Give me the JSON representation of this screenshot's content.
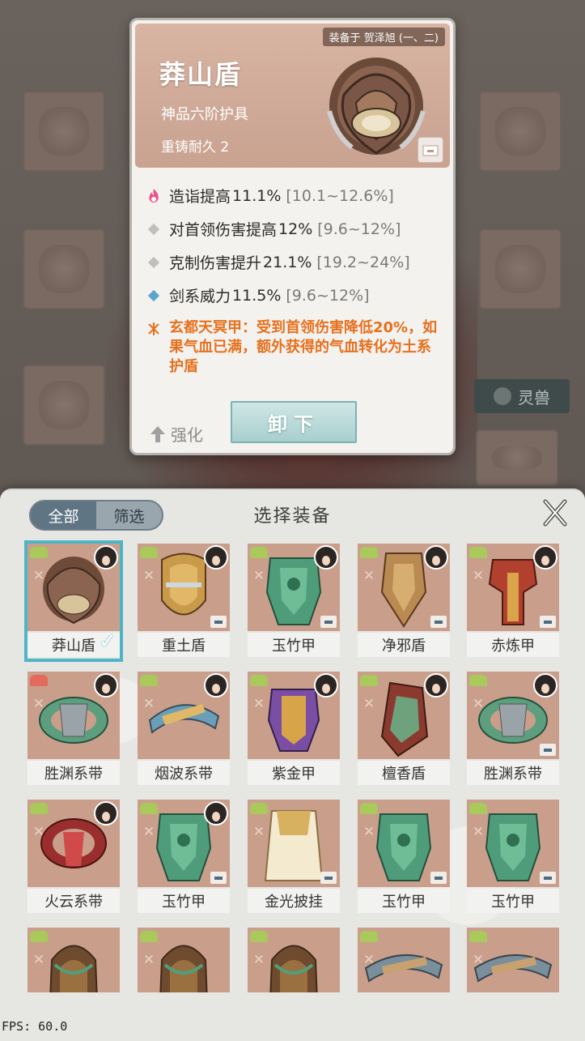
{
  "background": {
    "tab_lingshou": "灵兽"
  },
  "detail": {
    "equipped_on": "装备于 贺泽旭 (一、二)",
    "title": "莽山盾",
    "grade": "神品六阶护具",
    "recast": "重铸耐久 2",
    "stats": [
      {
        "label": "造诣提高",
        "value": "11.1%",
        "range": "[10.1~12.6%]",
        "icon": "flame-icon"
      },
      {
        "label": "对首领伤害提高",
        "value": "12%",
        "range": "[9.6~12%]",
        "icon": "diamond-icon"
      },
      {
        "label": "克制伤害提升",
        "value": "21.1%",
        "range": "[19.2~24%]",
        "icon": "diamond-icon"
      },
      {
        "label": "剑系威力",
        "value": "11.5%",
        "range": "[9.6~12%]",
        "icon": "diamond-blue-icon"
      }
    ],
    "special": "玄都天冥甲：受到首领伤害降低20%，如果气血已满，额外获得的气血转化为土系护盾",
    "enhance_label": "强化",
    "unequip_label": "卸下"
  },
  "picker": {
    "filter_all": "全部",
    "filter_screen": "筛选",
    "title": "选择装备",
    "items": [
      {
        "name": "莽山盾",
        "selected": true,
        "avatar": true,
        "chest": false,
        "badge": "green",
        "art": "shield-brown"
      },
      {
        "name": "重土盾",
        "selected": false,
        "avatar": true,
        "chest": true,
        "badge": "green",
        "art": "shield-gold"
      },
      {
        "name": "玉竹甲",
        "selected": false,
        "avatar": true,
        "chest": true,
        "badge": "green",
        "art": "armor-jade"
      },
      {
        "name": "净邪盾",
        "selected": false,
        "avatar": true,
        "chest": true,
        "badge": "green",
        "art": "shield-bronze"
      },
      {
        "name": "赤炼甲",
        "selected": false,
        "avatar": true,
        "chest": true,
        "badge": "green",
        "art": "armor-red"
      },
      {
        "name": "胜渊系带",
        "selected": false,
        "avatar": true,
        "chest": false,
        "badge": "red",
        "art": "belt-jade"
      },
      {
        "name": "烟波系带",
        "selected": false,
        "avatar": true,
        "chest": false,
        "badge": "green",
        "art": "belt-gold"
      },
      {
        "name": "紫金甲",
        "selected": false,
        "avatar": true,
        "chest": false,
        "badge": "green",
        "art": "armor-purple"
      },
      {
        "name": "檀香盾",
        "selected": false,
        "avatar": true,
        "chest": false,
        "badge": "green",
        "art": "shield-red"
      },
      {
        "name": "胜渊系带",
        "selected": false,
        "avatar": true,
        "chest": true,
        "badge": "green",
        "art": "belt-jade"
      },
      {
        "name": "火云系带",
        "selected": false,
        "avatar": true,
        "chest": false,
        "badge": "green",
        "art": "belt-red"
      },
      {
        "name": "玉竹甲",
        "selected": false,
        "avatar": true,
        "chest": true,
        "badge": "green",
        "art": "armor-jade"
      },
      {
        "name": "金光披挂",
        "selected": false,
        "avatar": false,
        "chest": true,
        "badge": "green",
        "art": "robe-gold"
      },
      {
        "name": "玉竹甲",
        "selected": false,
        "avatar": false,
        "chest": true,
        "badge": "green",
        "art": "armor-jade"
      },
      {
        "name": "玉竹甲",
        "selected": false,
        "avatar": false,
        "chest": true,
        "badge": "green",
        "art": "armor-jade"
      },
      {
        "name": "",
        "selected": false,
        "avatar": false,
        "chest": false,
        "badge": "green",
        "art": "shield-thorn"
      },
      {
        "name": "",
        "selected": false,
        "avatar": false,
        "chest": false,
        "badge": "green",
        "art": "shield-thorn"
      },
      {
        "name": "",
        "selected": false,
        "avatar": false,
        "chest": false,
        "badge": "green",
        "art": "shield-thorn"
      },
      {
        "name": "",
        "selected": false,
        "avatar": false,
        "chest": false,
        "badge": "green",
        "art": "belt-silver"
      },
      {
        "name": "",
        "selected": false,
        "avatar": false,
        "chest": false,
        "badge": "green",
        "art": "belt-silver"
      }
    ]
  },
  "fps": "FPS: 60.0"
}
